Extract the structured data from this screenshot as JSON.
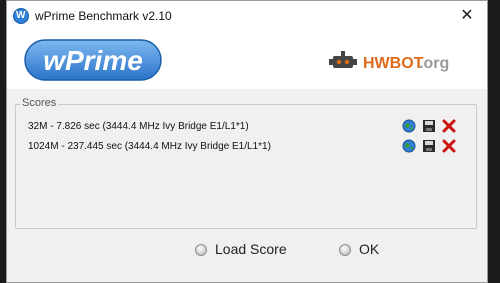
{
  "window": {
    "title": "wPrime Benchmark v2.10",
    "close_glyph": "✕"
  },
  "logos": {
    "left": "wPrime",
    "right_brand": "HWBOT",
    "right_suffix": ".org"
  },
  "scores": {
    "group_label": "Scores",
    "rows": [
      {
        "text": "32M - 7.826 sec (3444.4 MHz Ivy Bridge E1/L1*1)",
        "icons": [
          "globe-icon",
          "save-icon",
          "delete-icon"
        ]
      },
      {
        "text": "1024M - 237.445 sec (3444.4 MHz Ivy Bridge E1/L1*1)",
        "icons": [
          "globe-icon",
          "save-icon",
          "delete-icon"
        ]
      }
    ]
  },
  "actions": {
    "load_score": "Load Score",
    "ok": "OK"
  },
  "colors": {
    "accent_blue": "#2f7fd6",
    "delete_red": "#cc1111",
    "hwbot_orange": "#e06a1b"
  }
}
